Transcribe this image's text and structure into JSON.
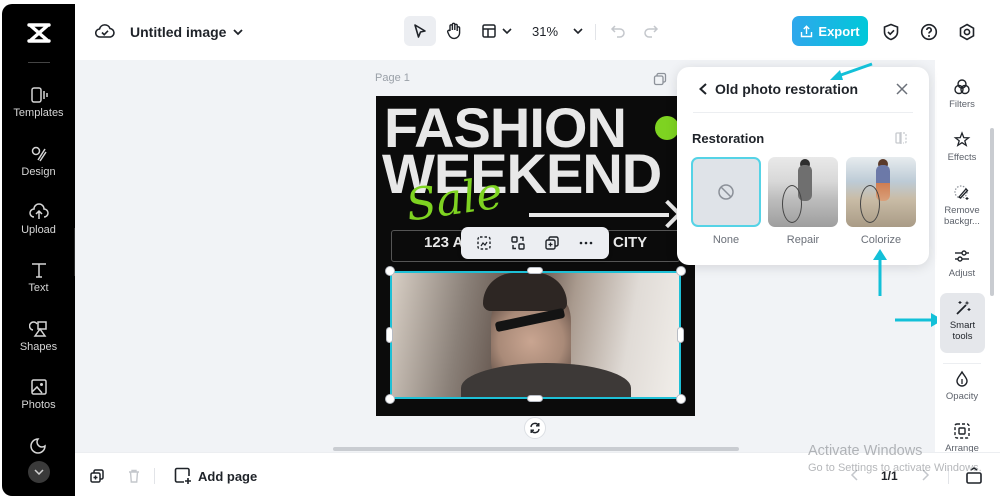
{
  "sidebar": {
    "logo": "capcut-logo",
    "items": [
      {
        "label": "Templates",
        "icon": "templates-icon"
      },
      {
        "label": "Design",
        "icon": "design-icon"
      },
      {
        "label": "Upload",
        "icon": "upload-icon"
      },
      {
        "label": "Text",
        "icon": "text-icon"
      },
      {
        "label": "Shapes",
        "icon": "shapes-icon"
      },
      {
        "label": "Photos",
        "icon": "photos-icon"
      },
      {
        "label": "Stickers",
        "icon": "stickers-icon"
      }
    ],
    "more_icon": "chevron-down-icon"
  },
  "header": {
    "title": "Untitled image",
    "zoom": "31%",
    "export_label": "Export"
  },
  "canvas": {
    "page_label": "Page 1",
    "poster": {
      "line1": "FASHION",
      "line2": "WEEKEND",
      "script": "Sale",
      "address_left": "123 A",
      "address_right": "CITY"
    }
  },
  "restoration_panel": {
    "title": "Old photo restoration",
    "section": "Restoration",
    "options": [
      {
        "label": "None",
        "selected": true
      },
      {
        "label": "Repair",
        "selected": false
      },
      {
        "label": "Colorize",
        "selected": false
      }
    ]
  },
  "right_toolbar": {
    "items": [
      {
        "label": "Filters"
      },
      {
        "label": "Effects"
      },
      {
        "label": "Remove backgr..."
      },
      {
        "label": "Adjust"
      },
      {
        "label": "Smart tools",
        "active": true
      },
      {
        "label": "Opacity"
      },
      {
        "label": "Arrange"
      }
    ]
  },
  "bottom": {
    "add_page_label": "Add page",
    "page_count": "1/1"
  },
  "watermark": {
    "line1": "Activate Windows",
    "line2": "Go to Settings to activate Windows."
  },
  "colors": {
    "accent": "#00c8d9",
    "sidebar_bg": "#000000",
    "poster_green": "#7ed321",
    "annotation": "#13c0d8"
  }
}
